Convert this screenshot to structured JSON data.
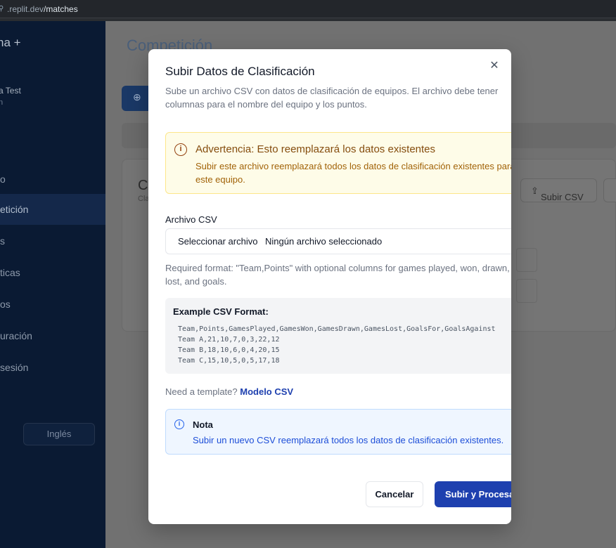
{
  "browser": {
    "lock_icon": "lock-icon",
    "url_host": ".replit.dev",
    "url_path": "/matches"
  },
  "sidebar": {
    "brand": "na +",
    "user_name": "a Test",
    "user_sub": "n",
    "items": [
      {
        "label": "o"
      },
      {
        "label": "etición"
      },
      {
        "label": "s"
      },
      {
        "label": "ticas"
      },
      {
        "label": "os"
      },
      {
        "label": "uración"
      },
      {
        "label": "sesión"
      }
    ],
    "language_button": "Inglés"
  },
  "background": {
    "title": "Competición",
    "card_letter": "C",
    "card_sub": "Cla",
    "csv_button": "Subir CSV"
  },
  "modal": {
    "title": "Subir Datos de Clasificación",
    "description": "Sube un archivo CSV con datos de clasificación de equipos. El archivo debe tener columnas para el nombre del equipo y los puntos.",
    "warning": {
      "title": "Advertencia: Esto reemplazará los datos existentes",
      "text": "Subir este archivo reemplazará todos los datos de clasificación existentes para este equipo."
    },
    "file_label": "Archivo CSV",
    "file_button": "Seleccionar archivo",
    "file_status": "Ningún archivo seleccionado",
    "hint": "Required format: \"Team,Points\" with optional columns for games played, won, drawn, lost, and goals.",
    "example": {
      "title": "Example CSV Format:",
      "lines": [
        "Team,Points,GamesPlayed,GamesWon,GamesDrawn,GamesLost,GoalsFor,GoalsAgainst",
        "Team A,21,10,7,0,3,22,12",
        "Team B,18,10,6,0,4,20,15",
        "Team C,15,10,5,0,5,17,18"
      ]
    },
    "template_text": "Need a template?",
    "template_link": "Modelo CSV",
    "note": {
      "title": "Nota",
      "text": "Subir un nuevo CSV reemplazará todos los datos de clasificación existentes."
    },
    "cancel_label": "Cancelar",
    "submit_label": "Subir y Procesar"
  }
}
